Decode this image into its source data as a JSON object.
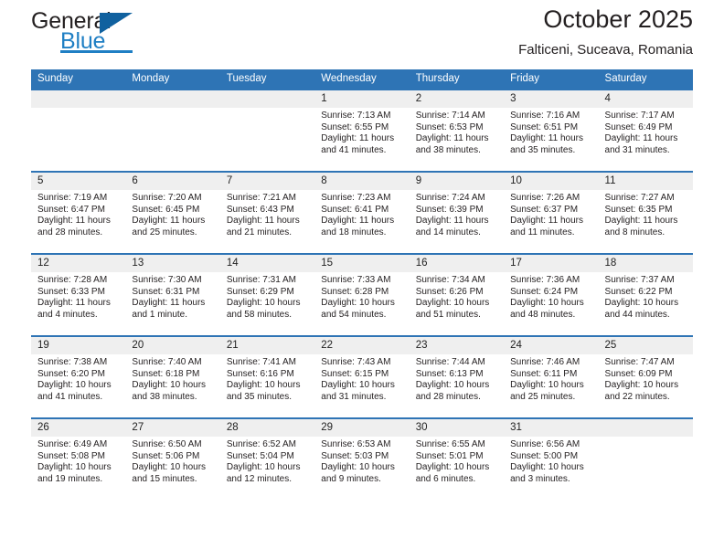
{
  "branding": {
    "name_part1": "General",
    "name_part2": "Blue",
    "triangle_color": "#10619f",
    "blue": "#1f7fc4"
  },
  "header": {
    "title": "October 2025",
    "subtitle": "Falticeni, Suceava, Romania"
  },
  "theme": {
    "header_row_bg": "#2e74b5",
    "daynum_bg": "#efefef",
    "text": "#231f20"
  },
  "calendar": {
    "day_names": [
      "Sunday",
      "Monday",
      "Tuesday",
      "Wednesday",
      "Thursday",
      "Friday",
      "Saturday"
    ],
    "weeks": [
      [
        {
          "day": "",
          "sunrise": "",
          "sunset": "",
          "daylight_line1": "",
          "daylight_line2": ""
        },
        {
          "day": "",
          "sunrise": "",
          "sunset": "",
          "daylight_line1": "",
          "daylight_line2": ""
        },
        {
          "day": "",
          "sunrise": "",
          "sunset": "",
          "daylight_line1": "",
          "daylight_line2": ""
        },
        {
          "day": "1",
          "sunrise": "Sunrise: 7:13 AM",
          "sunset": "Sunset: 6:55 PM",
          "daylight_line1": "Daylight: 11 hours",
          "daylight_line2": "and 41 minutes."
        },
        {
          "day": "2",
          "sunrise": "Sunrise: 7:14 AM",
          "sunset": "Sunset: 6:53 PM",
          "daylight_line1": "Daylight: 11 hours",
          "daylight_line2": "and 38 minutes."
        },
        {
          "day": "3",
          "sunrise": "Sunrise: 7:16 AM",
          "sunset": "Sunset: 6:51 PM",
          "daylight_line1": "Daylight: 11 hours",
          "daylight_line2": "and 35 minutes."
        },
        {
          "day": "4",
          "sunrise": "Sunrise: 7:17 AM",
          "sunset": "Sunset: 6:49 PM",
          "daylight_line1": "Daylight: 11 hours",
          "daylight_line2": "and 31 minutes."
        }
      ],
      [
        {
          "day": "5",
          "sunrise": "Sunrise: 7:19 AM",
          "sunset": "Sunset: 6:47 PM",
          "daylight_line1": "Daylight: 11 hours",
          "daylight_line2": "and 28 minutes."
        },
        {
          "day": "6",
          "sunrise": "Sunrise: 7:20 AM",
          "sunset": "Sunset: 6:45 PM",
          "daylight_line1": "Daylight: 11 hours",
          "daylight_line2": "and 25 minutes."
        },
        {
          "day": "7",
          "sunrise": "Sunrise: 7:21 AM",
          "sunset": "Sunset: 6:43 PM",
          "daylight_line1": "Daylight: 11 hours",
          "daylight_line2": "and 21 minutes."
        },
        {
          "day": "8",
          "sunrise": "Sunrise: 7:23 AM",
          "sunset": "Sunset: 6:41 PM",
          "daylight_line1": "Daylight: 11 hours",
          "daylight_line2": "and 18 minutes."
        },
        {
          "day": "9",
          "sunrise": "Sunrise: 7:24 AM",
          "sunset": "Sunset: 6:39 PM",
          "daylight_line1": "Daylight: 11 hours",
          "daylight_line2": "and 14 minutes."
        },
        {
          "day": "10",
          "sunrise": "Sunrise: 7:26 AM",
          "sunset": "Sunset: 6:37 PM",
          "daylight_line1": "Daylight: 11 hours",
          "daylight_line2": "and 11 minutes."
        },
        {
          "day": "11",
          "sunrise": "Sunrise: 7:27 AM",
          "sunset": "Sunset: 6:35 PM",
          "daylight_line1": "Daylight: 11 hours",
          "daylight_line2": "and 8 minutes."
        }
      ],
      [
        {
          "day": "12",
          "sunrise": "Sunrise: 7:28 AM",
          "sunset": "Sunset: 6:33 PM",
          "daylight_line1": "Daylight: 11 hours",
          "daylight_line2": "and 4 minutes."
        },
        {
          "day": "13",
          "sunrise": "Sunrise: 7:30 AM",
          "sunset": "Sunset: 6:31 PM",
          "daylight_line1": "Daylight: 11 hours",
          "daylight_line2": "and 1 minute."
        },
        {
          "day": "14",
          "sunrise": "Sunrise: 7:31 AM",
          "sunset": "Sunset: 6:29 PM",
          "daylight_line1": "Daylight: 10 hours",
          "daylight_line2": "and 58 minutes."
        },
        {
          "day": "15",
          "sunrise": "Sunrise: 7:33 AM",
          "sunset": "Sunset: 6:28 PM",
          "daylight_line1": "Daylight: 10 hours",
          "daylight_line2": "and 54 minutes."
        },
        {
          "day": "16",
          "sunrise": "Sunrise: 7:34 AM",
          "sunset": "Sunset: 6:26 PM",
          "daylight_line1": "Daylight: 10 hours",
          "daylight_line2": "and 51 minutes."
        },
        {
          "day": "17",
          "sunrise": "Sunrise: 7:36 AM",
          "sunset": "Sunset: 6:24 PM",
          "daylight_line1": "Daylight: 10 hours",
          "daylight_line2": "and 48 minutes."
        },
        {
          "day": "18",
          "sunrise": "Sunrise: 7:37 AM",
          "sunset": "Sunset: 6:22 PM",
          "daylight_line1": "Daylight: 10 hours",
          "daylight_line2": "and 44 minutes."
        }
      ],
      [
        {
          "day": "19",
          "sunrise": "Sunrise: 7:38 AM",
          "sunset": "Sunset: 6:20 PM",
          "daylight_line1": "Daylight: 10 hours",
          "daylight_line2": "and 41 minutes."
        },
        {
          "day": "20",
          "sunrise": "Sunrise: 7:40 AM",
          "sunset": "Sunset: 6:18 PM",
          "daylight_line1": "Daylight: 10 hours",
          "daylight_line2": "and 38 minutes."
        },
        {
          "day": "21",
          "sunrise": "Sunrise: 7:41 AM",
          "sunset": "Sunset: 6:16 PM",
          "daylight_line1": "Daylight: 10 hours",
          "daylight_line2": "and 35 minutes."
        },
        {
          "day": "22",
          "sunrise": "Sunrise: 7:43 AM",
          "sunset": "Sunset: 6:15 PM",
          "daylight_line1": "Daylight: 10 hours",
          "daylight_line2": "and 31 minutes."
        },
        {
          "day": "23",
          "sunrise": "Sunrise: 7:44 AM",
          "sunset": "Sunset: 6:13 PM",
          "daylight_line1": "Daylight: 10 hours",
          "daylight_line2": "and 28 minutes."
        },
        {
          "day": "24",
          "sunrise": "Sunrise: 7:46 AM",
          "sunset": "Sunset: 6:11 PM",
          "daylight_line1": "Daylight: 10 hours",
          "daylight_line2": "and 25 minutes."
        },
        {
          "day": "25",
          "sunrise": "Sunrise: 7:47 AM",
          "sunset": "Sunset: 6:09 PM",
          "daylight_line1": "Daylight: 10 hours",
          "daylight_line2": "and 22 minutes."
        }
      ],
      [
        {
          "day": "26",
          "sunrise": "Sunrise: 6:49 AM",
          "sunset": "Sunset: 5:08 PM",
          "daylight_line1": "Daylight: 10 hours",
          "daylight_line2": "and 19 minutes."
        },
        {
          "day": "27",
          "sunrise": "Sunrise: 6:50 AM",
          "sunset": "Sunset: 5:06 PM",
          "daylight_line1": "Daylight: 10 hours",
          "daylight_line2": "and 15 minutes."
        },
        {
          "day": "28",
          "sunrise": "Sunrise: 6:52 AM",
          "sunset": "Sunset: 5:04 PM",
          "daylight_line1": "Daylight: 10 hours",
          "daylight_line2": "and 12 minutes."
        },
        {
          "day": "29",
          "sunrise": "Sunrise: 6:53 AM",
          "sunset": "Sunset: 5:03 PM",
          "daylight_line1": "Daylight: 10 hours",
          "daylight_line2": "and 9 minutes."
        },
        {
          "day": "30",
          "sunrise": "Sunrise: 6:55 AM",
          "sunset": "Sunset: 5:01 PM",
          "daylight_line1": "Daylight: 10 hours",
          "daylight_line2": "and 6 minutes."
        },
        {
          "day": "31",
          "sunrise": "Sunrise: 6:56 AM",
          "sunset": "Sunset: 5:00 PM",
          "daylight_line1": "Daylight: 10 hours",
          "daylight_line2": "and 3 minutes."
        },
        {
          "day": "",
          "sunrise": "",
          "sunset": "",
          "daylight_line1": "",
          "daylight_line2": ""
        }
      ]
    ]
  }
}
